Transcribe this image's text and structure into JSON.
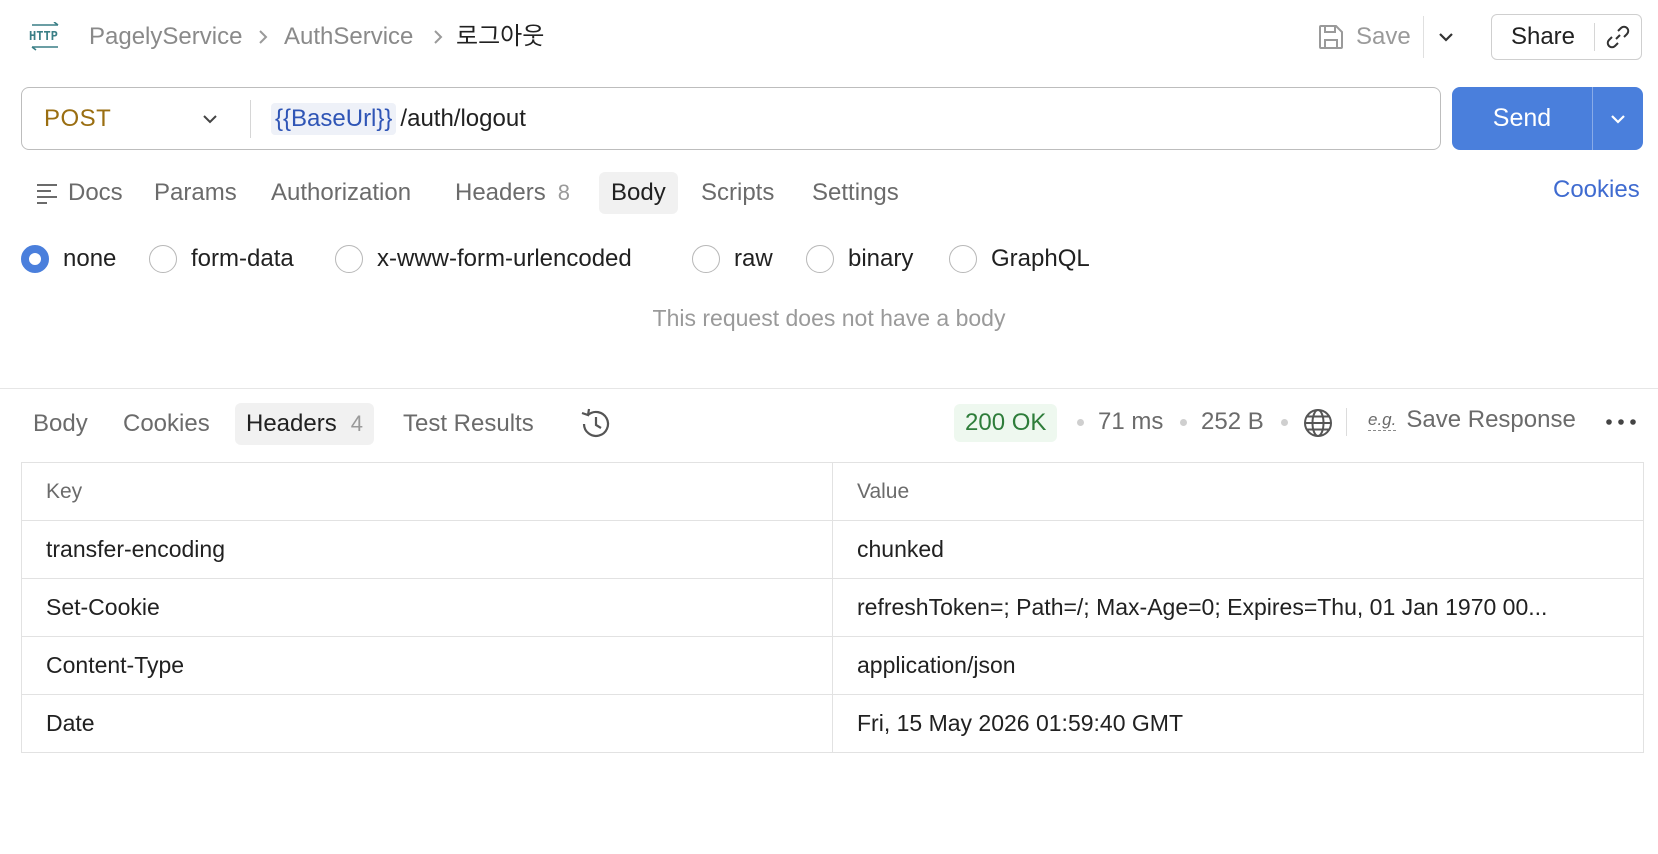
{
  "header": {
    "logo_text": "HTTP",
    "breadcrumbs": [
      "PagelyService",
      "AuthService",
      "로그아웃"
    ],
    "save_label": "Save",
    "share_label": "Share"
  },
  "request": {
    "method": "POST",
    "url_variable": "{{BaseUrl}}",
    "url_path": "/auth/logout",
    "send_label": "Send",
    "tabs": [
      {
        "label": "Docs"
      },
      {
        "label": "Params"
      },
      {
        "label": "Authorization"
      },
      {
        "label": "Headers",
        "count": "8"
      },
      {
        "label": "Body"
      },
      {
        "label": "Scripts"
      },
      {
        "label": "Settings"
      }
    ],
    "active_tab": "Body",
    "cookies_label": "Cookies",
    "body_types": [
      "none",
      "form-data",
      "x-www-form-urlencoded",
      "raw",
      "binary",
      "GraphQL"
    ],
    "selected_body_type": "none",
    "empty_body_message": "This request does not have a body"
  },
  "response": {
    "tabs": [
      {
        "label": "Body"
      },
      {
        "label": "Cookies"
      },
      {
        "label": "Headers",
        "count": "4"
      },
      {
        "label": "Test Results"
      }
    ],
    "active_tab": "Headers",
    "status": "200 OK",
    "time": "71 ms",
    "size": "252 B",
    "save_response_label": "Save Response",
    "eg_label": "e.g.",
    "table": {
      "columns": [
        "Key",
        "Value"
      ],
      "rows": [
        [
          "transfer-encoding",
          "chunked"
        ],
        [
          "Set-Cookie",
          "refreshToken=; Path=/; Max-Age=0; Expires=Thu, 01 Jan 1970 00..."
        ],
        [
          "Content-Type",
          "application/json"
        ],
        [
          "Date",
          "Fri, 15 May 2026 01:59:40 GMT"
        ]
      ]
    }
  },
  "colors": {
    "accent": "#4a7fdc",
    "method": "#9a6e11",
    "status_ok": "#2e7d3a",
    "link": "#3f6bd0"
  },
  "icons": [
    "http-logo-icon",
    "chevron-right-icon",
    "save-icon",
    "chevron-down-icon",
    "link-icon",
    "docs-icon",
    "history-icon",
    "globe-icon",
    "more-icon"
  ]
}
